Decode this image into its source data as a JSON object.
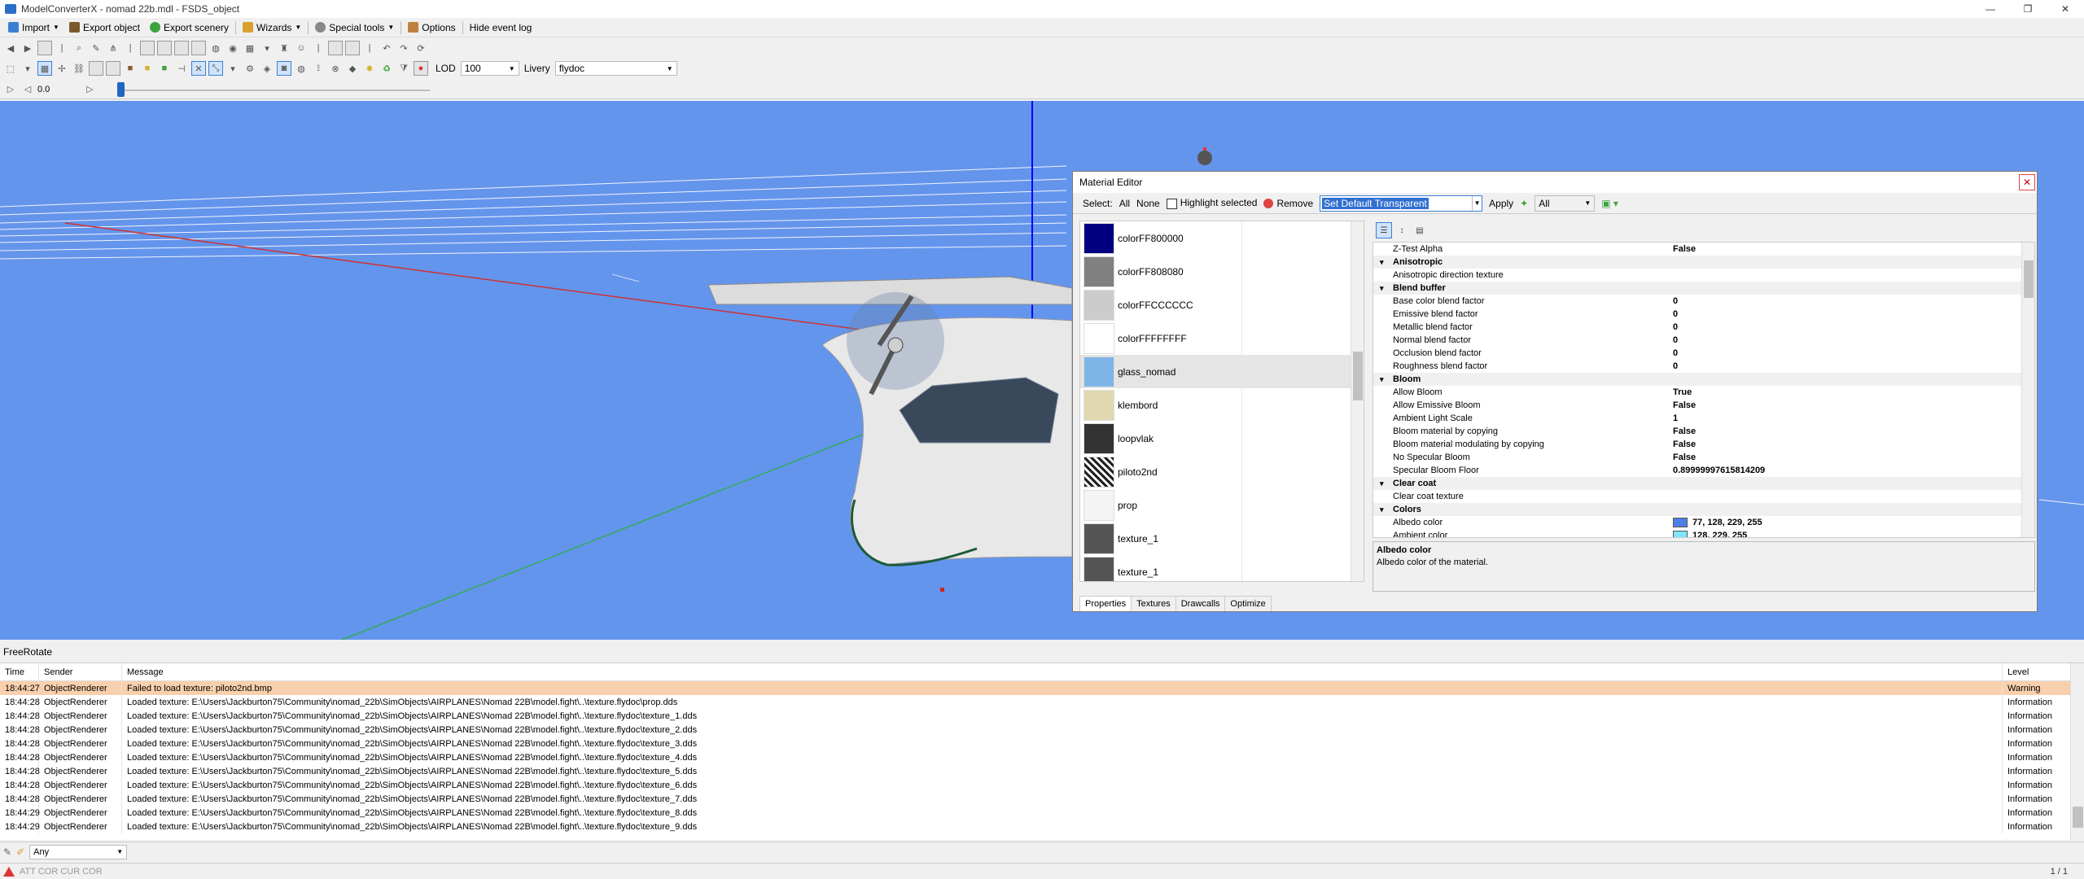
{
  "window": {
    "title": "ModelConverterX - nomad 22b.mdl - FSDS_object",
    "minimize": "—",
    "restore": "❐",
    "close": "✕"
  },
  "menu": {
    "items": [
      {
        "label": "Import",
        "icon": "import-icon",
        "dropdown": true
      },
      {
        "label": "Export object",
        "icon": "export-object-icon",
        "dropdown": false
      },
      {
        "label": "Export scenery",
        "icon": "export-scenery-icon",
        "dropdown": false
      },
      {
        "label": "Wizards",
        "icon": "wizard-icon",
        "dropdown": true
      },
      {
        "label": "Special tools",
        "icon": "gear-icon",
        "dropdown": true
      },
      {
        "label": "Options",
        "icon": "wrench-icon",
        "dropdown": false
      },
      {
        "label": "Hide event log",
        "icon": "",
        "dropdown": false
      }
    ]
  },
  "toolbar2": {
    "lod_label": "LOD",
    "lod_value": "100",
    "livery_label": "Livery",
    "livery_value": "flydoc"
  },
  "toolbar3": {
    "time_value": "0.0"
  },
  "material_editor": {
    "title": "Material Editor",
    "close": "✕",
    "select_label": "Select:",
    "all_label": "All",
    "none_label": "None",
    "highlight_label": "Highlight selected",
    "remove_label": "Remove",
    "preset_value": "Set Default Transparent",
    "apply_label": "Apply",
    "filter_value": "All",
    "materials": [
      {
        "name": "colorFF800000",
        "color": "#000080"
      },
      {
        "name": "colorFF808080",
        "color": "#808080"
      },
      {
        "name": "colorFFCCCCCC",
        "color": "#CCCCCC"
      },
      {
        "name": "colorFFFFFFFF",
        "color": "#FFFFFF"
      },
      {
        "name": "glass_nomad",
        "color": "#7fb5e6"
      },
      {
        "name": "klembord",
        "color": "#e0d8b0"
      },
      {
        "name": "loopvlak",
        "color": "#333333"
      },
      {
        "name": "piloto2nd",
        "color": "#c8c8c8"
      },
      {
        "name": "prop",
        "color": "#f4f4f4"
      },
      {
        "name": "texture_1",
        "color": "#555555"
      },
      {
        "name": "texture_1",
        "color": "#555555"
      }
    ],
    "properties": [
      {
        "type": "row",
        "key": "Z-Test Alpha",
        "value": "False"
      },
      {
        "type": "cat",
        "key": "Anisotropic"
      },
      {
        "type": "row",
        "key": "Anisotropic direction texture",
        "value": ""
      },
      {
        "type": "cat",
        "key": "Blend buffer"
      },
      {
        "type": "row",
        "key": "Base color blend factor",
        "value": "0"
      },
      {
        "type": "row",
        "key": "Emissive blend factor",
        "value": "0"
      },
      {
        "type": "row",
        "key": "Metallic blend factor",
        "value": "0"
      },
      {
        "type": "row",
        "key": "Normal blend factor",
        "value": "0"
      },
      {
        "type": "row",
        "key": "Occlusion blend factor",
        "value": "0"
      },
      {
        "type": "row",
        "key": "Roughness blend factor",
        "value": "0"
      },
      {
        "type": "cat",
        "key": "Bloom"
      },
      {
        "type": "row",
        "key": "Allow Bloom",
        "value": "True"
      },
      {
        "type": "row",
        "key": "Allow Emissive Bloom",
        "value": "False"
      },
      {
        "type": "row",
        "key": "Ambient Light Scale",
        "value": "1"
      },
      {
        "type": "row",
        "key": "Bloom material by copying",
        "value": "False"
      },
      {
        "type": "row",
        "key": "Bloom material modulating by copying",
        "value": "False"
      },
      {
        "type": "row",
        "key": "No Specular Bloom",
        "value": "False"
      },
      {
        "type": "row",
        "key": "Specular Bloom Floor",
        "value": "0.89999997615814209"
      },
      {
        "type": "cat",
        "key": "Clear coat"
      },
      {
        "type": "row",
        "key": "Clear coat texture",
        "value": ""
      },
      {
        "type": "cat",
        "key": "Colors"
      },
      {
        "type": "row",
        "key": "Albedo color",
        "value": "77, 128, 229, 255",
        "swatch": "#4d80e5"
      },
      {
        "type": "row",
        "key": "Ambient color",
        "value": "128, 229, 255",
        "swatch": "#80e5ff"
      }
    ],
    "description_title": "Albedo color",
    "description_text": "Albedo color of the material.",
    "tabs": [
      "Properties",
      "Textures",
      "Drawcalls",
      "Optimize"
    ]
  },
  "freerotate_label": "FreeRotate",
  "log": {
    "headers": {
      "time": "Time",
      "sender": "Sender",
      "message": "Message",
      "level": "Level"
    },
    "rows": [
      {
        "time": "18:44:27",
        "sender": "ObjectRenderer",
        "message": "Failed to load texture: piloto2nd.bmp",
        "level": "Warning",
        "warn": true
      },
      {
        "time": "18:44:28",
        "sender": "ObjectRenderer",
        "message": "Loaded texture: E:\\Users\\Jackburton75\\Community\\nomad_22b\\SimObjects\\AIRPLANES\\Nomad 22B\\model.fight\\..\\texture.flydoc\\prop.dds",
        "level": "Information"
      },
      {
        "time": "18:44:28",
        "sender": "ObjectRenderer",
        "message": "Loaded texture: E:\\Users\\Jackburton75\\Community\\nomad_22b\\SimObjects\\AIRPLANES\\Nomad 22B\\model.fight\\..\\texture.flydoc\\texture_1.dds",
        "level": "Information"
      },
      {
        "time": "18:44:28",
        "sender": "ObjectRenderer",
        "message": "Loaded texture: E:\\Users\\Jackburton75\\Community\\nomad_22b\\SimObjects\\AIRPLANES\\Nomad 22B\\model.fight\\..\\texture.flydoc\\texture_2.dds",
        "level": "Information"
      },
      {
        "time": "18:44:28",
        "sender": "ObjectRenderer",
        "message": "Loaded texture: E:\\Users\\Jackburton75\\Community\\nomad_22b\\SimObjects\\AIRPLANES\\Nomad 22B\\model.fight\\..\\texture.flydoc\\texture_3.dds",
        "level": "Information"
      },
      {
        "time": "18:44:28",
        "sender": "ObjectRenderer",
        "message": "Loaded texture: E:\\Users\\Jackburton75\\Community\\nomad_22b\\SimObjects\\AIRPLANES\\Nomad 22B\\model.fight\\..\\texture.flydoc\\texture_4.dds",
        "level": "Information"
      },
      {
        "time": "18:44:28",
        "sender": "ObjectRenderer",
        "message": "Loaded texture: E:\\Users\\Jackburton75\\Community\\nomad_22b\\SimObjects\\AIRPLANES\\Nomad 22B\\model.fight\\..\\texture.flydoc\\texture_5.dds",
        "level": "Information"
      },
      {
        "time": "18:44:28",
        "sender": "ObjectRenderer",
        "message": "Loaded texture: E:\\Users\\Jackburton75\\Community\\nomad_22b\\SimObjects\\AIRPLANES\\Nomad 22B\\model.fight\\..\\texture.flydoc\\texture_6.dds",
        "level": "Information"
      },
      {
        "time": "18:44:28",
        "sender": "ObjectRenderer",
        "message": "Loaded texture: E:\\Users\\Jackburton75\\Community\\nomad_22b\\SimObjects\\AIRPLANES\\Nomad 22B\\model.fight\\..\\texture.flydoc\\texture_7.dds",
        "level": "Information"
      },
      {
        "time": "18:44:29",
        "sender": "ObjectRenderer",
        "message": "Loaded texture: E:\\Users\\Jackburton75\\Community\\nomad_22b\\SimObjects\\AIRPLANES\\Nomad 22B\\model.fight\\..\\texture.flydoc\\texture_8.dds",
        "level": "Information"
      },
      {
        "time": "18:44:29",
        "sender": "ObjectRenderer",
        "message": "Loaded texture: E:\\Users\\Jackburton75\\Community\\nomad_22b\\SimObjects\\AIRPLANES\\Nomad 22B\\model.fight\\..\\texture.flydoc\\texture_9.dds",
        "level": "Information"
      }
    ],
    "filter_value": "Any"
  },
  "status": {
    "left": "ATT COR   CUR COR",
    "page": "1 / 1"
  }
}
